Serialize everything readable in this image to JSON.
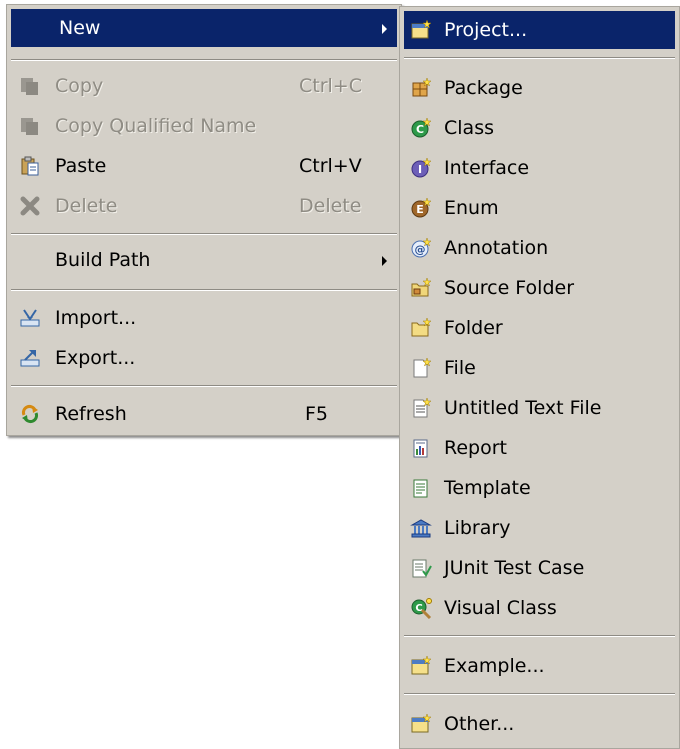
{
  "main_menu": {
    "new": {
      "label": "New"
    },
    "copy": {
      "label": "Copy",
      "shortcut": "Ctrl+C"
    },
    "copy_qualified": {
      "label": "Copy Qualified Name"
    },
    "paste": {
      "label": "Paste",
      "shortcut": "Ctrl+V"
    },
    "delete": {
      "label": "Delete",
      "shortcut": "Delete"
    },
    "build_path": {
      "label": "Build Path"
    },
    "import": {
      "label": "Import..."
    },
    "export": {
      "label": "Export..."
    },
    "refresh": {
      "label": "Refresh",
      "shortcut": "F5"
    }
  },
  "submenu": {
    "items": [
      {
        "label": "Project...",
        "icon": "project-icon"
      },
      {
        "label": "Package",
        "icon": "package-icon"
      },
      {
        "label": "Class",
        "icon": "class-icon"
      },
      {
        "label": "Interface",
        "icon": "interface-icon"
      },
      {
        "label": "Enum",
        "icon": "enum-icon"
      },
      {
        "label": "Annotation",
        "icon": "annotation-icon"
      },
      {
        "label": "Source Folder",
        "icon": "source-folder-icon"
      },
      {
        "label": "Folder",
        "icon": "folder-icon"
      },
      {
        "label": "File",
        "icon": "file-icon"
      },
      {
        "label": "Untitled Text File",
        "icon": "text-file-icon"
      },
      {
        "label": "Report",
        "icon": "report-icon"
      },
      {
        "label": "Template",
        "icon": "template-icon"
      },
      {
        "label": "Library",
        "icon": "library-icon"
      },
      {
        "label": "JUnit Test Case",
        "icon": "junit-icon"
      },
      {
        "label": "Visual Class",
        "icon": "visual-class-icon"
      },
      {
        "label": "Example...",
        "icon": "example-icon"
      },
      {
        "label": "Other...",
        "icon": "other-icon"
      }
    ]
  },
  "colors": {
    "menu_bg": "#d4d0c8",
    "highlight": "#0a246a",
    "disabled_text": "#8f8c84"
  }
}
